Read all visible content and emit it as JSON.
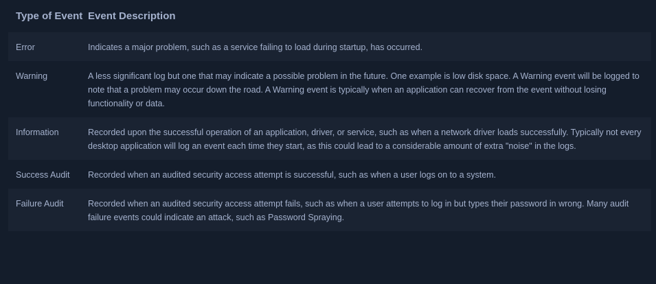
{
  "table": {
    "headers": {
      "type": "Type of Event",
      "description": "Event Description"
    },
    "rows": [
      {
        "type": "Error",
        "description": "Indicates a major problem, such as a service failing to load during startup, has occurred."
      },
      {
        "type": "Warning",
        "description": "A less significant log but one that may indicate a possible problem in the future. One example is low disk space. A Warning event will be logged to note that a problem may occur down the road. A Warning event is typically when an application can recover from the event without losing functionality or data."
      },
      {
        "type": "Information",
        "description": "Recorded upon the successful operation of an application, driver, or service, such as when a network driver loads successfully. Typically not every desktop application will log an event each time they start, as this could lead to a considerable amount of extra \"noise\" in the logs."
      },
      {
        "type": "Success Audit",
        "description": "Recorded when an audited security access attempt is successful, such as when a user logs on to a system."
      },
      {
        "type": "Failure Audit",
        "description": "Recorded when an audited security access attempt fails, such as when a user attempts to log in but types their password in wrong. Many audit failure events could indicate an attack, such as Password Spraying."
      }
    ]
  }
}
